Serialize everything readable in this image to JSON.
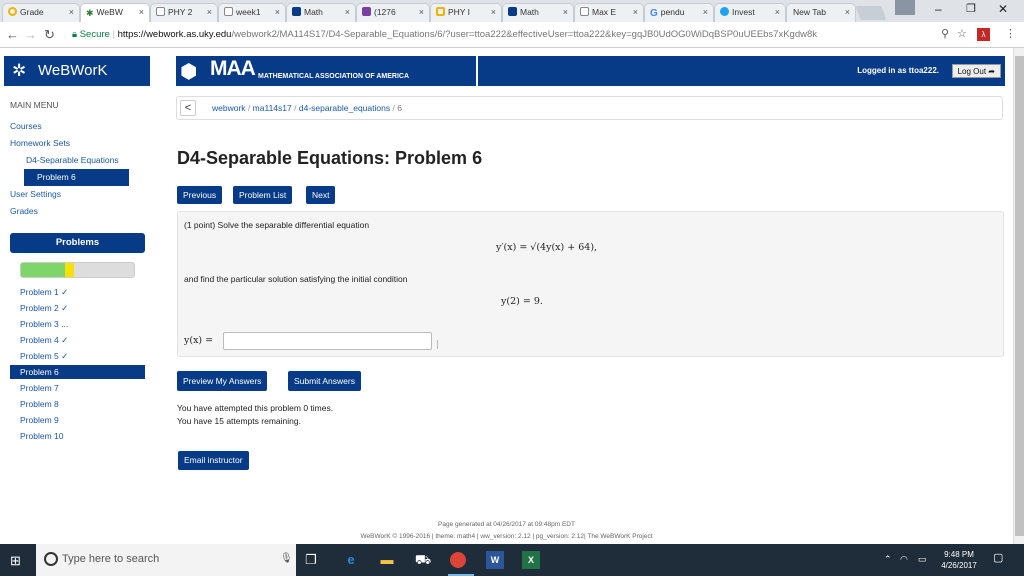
{
  "browser": {
    "tabs": [
      {
        "label": "Grade",
        "color": "#f0b400"
      },
      {
        "label": "WeBW",
        "color": "#2e7d32"
      },
      {
        "label": "PHY 2",
        "color": "#bbbbbb"
      },
      {
        "label": "week1",
        "color": "#bbbbbb"
      },
      {
        "label": "Math",
        "color": "#073b87"
      },
      {
        "label": "(1276",
        "color": "#7b3fa0"
      },
      {
        "label": "PHY I",
        "color": "#f0b400"
      },
      {
        "label": "Math",
        "color": "#073b87"
      },
      {
        "label": "Max E",
        "color": "#bbbbbb"
      },
      {
        "label": "pendu",
        "color": "#4285f4"
      },
      {
        "label": "Invest",
        "color": "#1da1f2"
      },
      {
        "label": "New Tab",
        "color": "#dfe3e8"
      }
    ],
    "url_secure": "Secure",
    "url_domain": "https://webwork.as.uky.edu",
    "url_rest": "/webwork2/MA114S17/D4-Separable_Equations/6/?user=ttoa222&effectiveUser=ttoa222&key=gqJB0UdOG0WiDqBSP0uUEEbs7xKgdw8k"
  },
  "header": {
    "logo": "WeBWorK",
    "maa_big": "MAA",
    "maa_small": "MATHEMATICAL ASSOCIATION OF AMERICA",
    "logged_in": "Logged in as ttoa222.",
    "logout": "Log Out"
  },
  "sidebar": {
    "main_menu": "MAIN MENU",
    "courses": "Courses",
    "homework_sets": "Homework Sets",
    "set_name": "D4-Separable Equations",
    "problem_current": "Problem 6",
    "user_settings": "User Settings",
    "grades": "Grades",
    "problems_heading": "Problems",
    "progress": {
      "correct_fraction": 0.39,
      "partial_fraction": 0.08
    },
    "problems": [
      {
        "label": "Problem 1 ✓"
      },
      {
        "label": "Problem 2 ✓"
      },
      {
        "label": "Problem 3 ..."
      },
      {
        "label": "Problem 4 ✓"
      },
      {
        "label": "Problem 5 ✓"
      },
      {
        "label": "Problem 6"
      },
      {
        "label": "Problem 7"
      },
      {
        "label": "Problem 8"
      },
      {
        "label": "Problem 9"
      },
      {
        "label": "Problem 10"
      }
    ]
  },
  "breadcrumb": {
    "back": "<",
    "p1": "webwork",
    "p2": "ma114s17",
    "p3": "d4-separable_equations",
    "p4": "6",
    "sep": "/"
  },
  "main": {
    "title": "D4-Separable Equations: Problem 6",
    "btn_previous": "Previous",
    "btn_list": "Problem List",
    "btn_next": "Next",
    "text1": "(1 point) Solve the separable differential equation",
    "eq1": "y′(x) = √(4y(x) + 64),",
    "text2": "and find the particular solution satisfying the initial condition",
    "eq2": "y(2) = 9.",
    "answer_label": "y(x) =",
    "answer_value": "",
    "btn_preview": "Preview My Answers",
    "btn_submit": "Submit Answers",
    "attempted": "You have attempted this problem 0 times.",
    "remaining": "You have 15 attempts remaining.",
    "btn_email": "Email instructor"
  },
  "footer": {
    "generated": "Page generated at 04/26/2017 at 09:48pm EDT",
    "credits": "WeBWorK © 1996-2016 | theme: math4 | ww_version: 2.12 | pg_version: 2.12| The WeBWorK Project"
  },
  "taskbar": {
    "search_placeholder": "Type here to search",
    "time": "9:48 PM",
    "date": "4/26/2017"
  }
}
